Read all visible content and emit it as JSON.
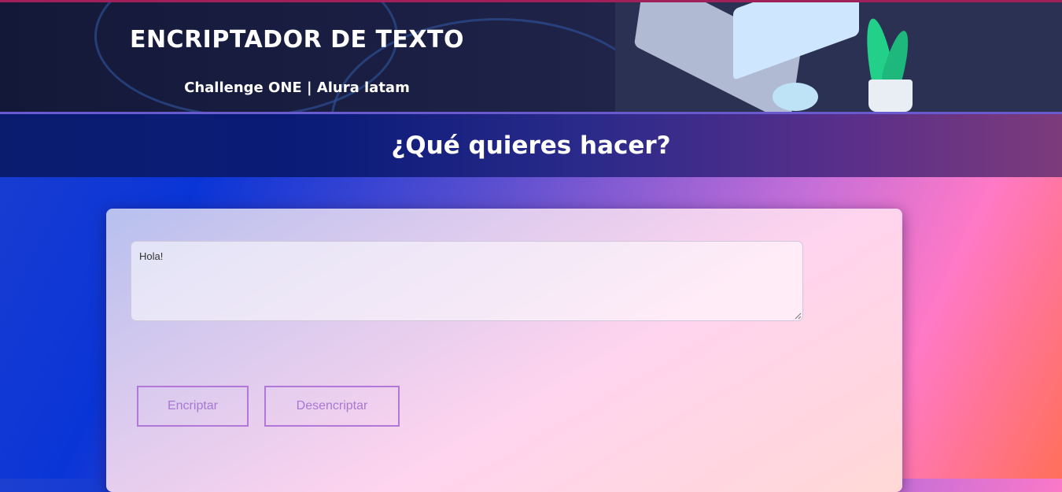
{
  "header": {
    "title": "ENCRIPTADOR DE TEXTO",
    "subtitle": "Challenge ONE | Alura latam"
  },
  "section": {
    "question": "¿Qué quieres hacer?"
  },
  "form": {
    "input_value": "Hola!",
    "encrypt_label": "Encriptar",
    "decrypt_label": "Desencriptar"
  },
  "colors": {
    "banner_border": "#a0205a",
    "button_border": "#b178d8",
    "button_text": "#a878d0"
  }
}
